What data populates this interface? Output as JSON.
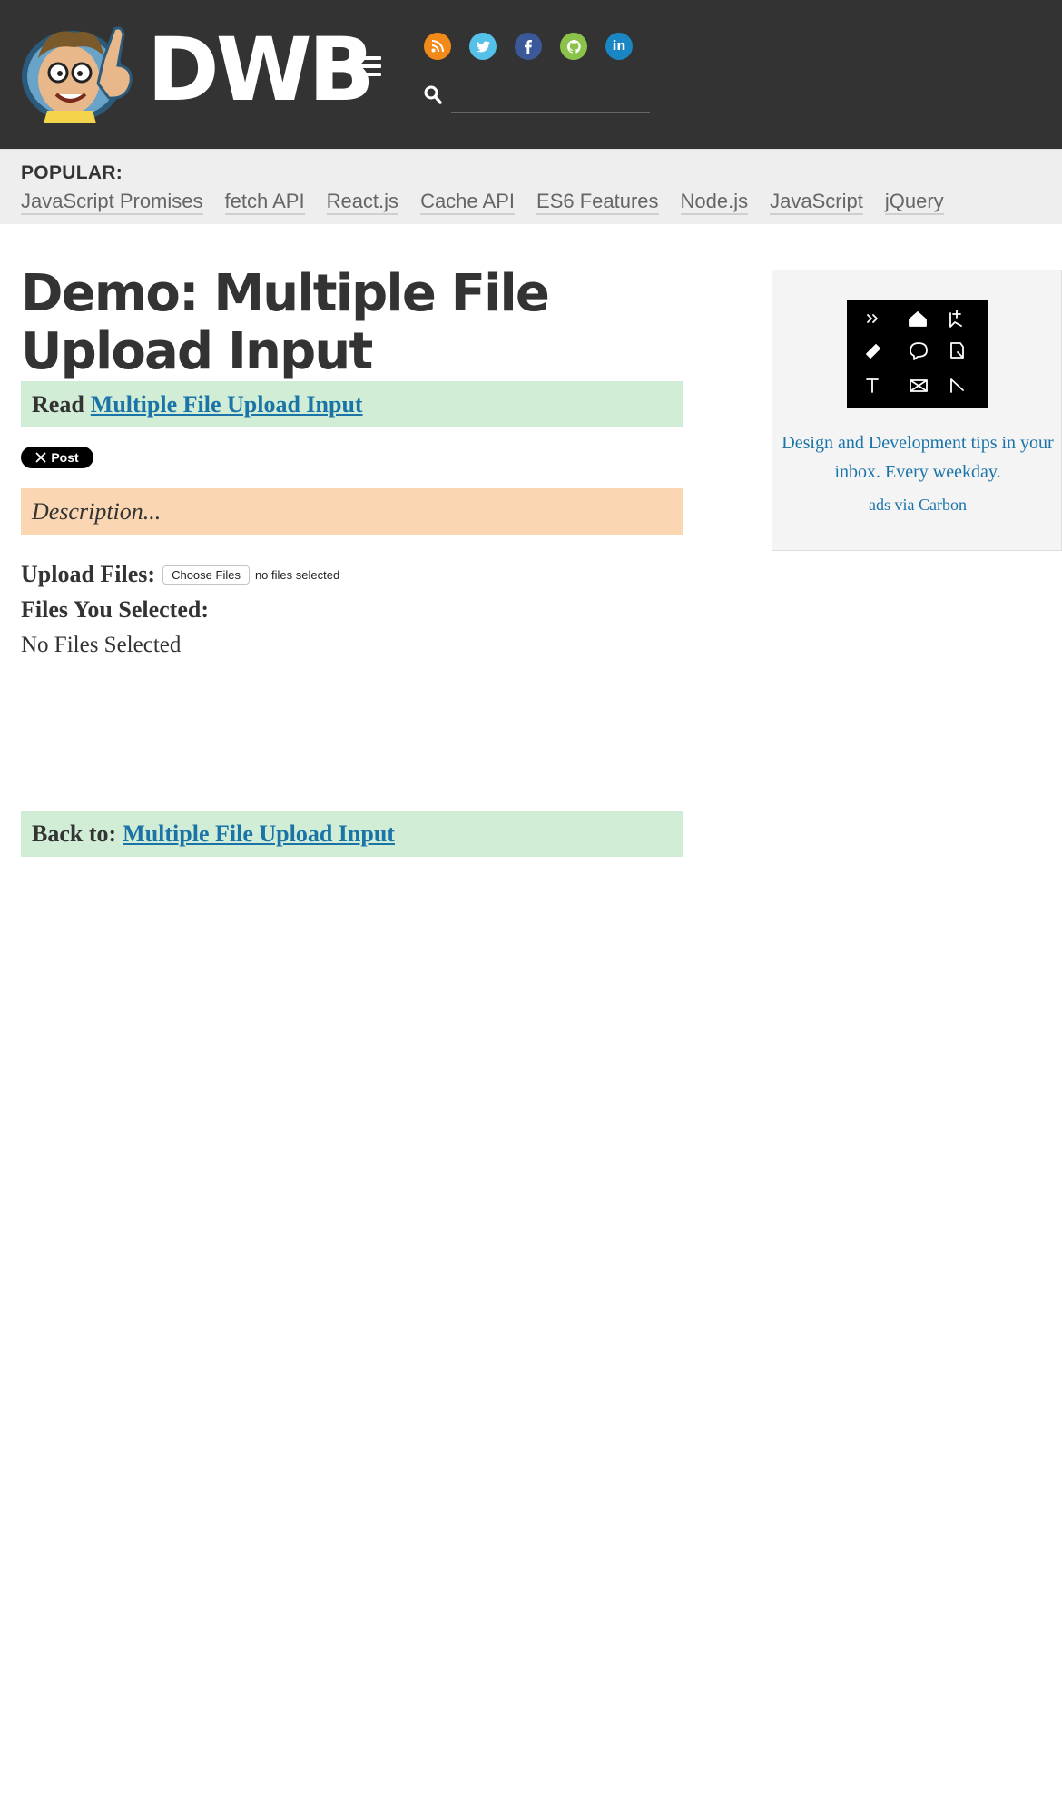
{
  "header": {
    "logo_text": "DWB",
    "social": [
      {
        "name": "rss",
        "color": "#f28a1a",
        "glyph": "rss-icon"
      },
      {
        "name": "twitter",
        "color": "#55c0e8",
        "glyph": "twitter-icon"
      },
      {
        "name": "facebook",
        "color": "#3b5998",
        "glyph": "facebook-icon"
      },
      {
        "name": "github",
        "color": "#8bc34a",
        "glyph": "github-icon"
      },
      {
        "name": "linkedin",
        "color": "#1a86c4",
        "glyph": "linkedin-icon"
      }
    ],
    "search_value": ""
  },
  "popular": {
    "label": "POPULAR:",
    "links": [
      "JavaScript Promises",
      "fetch API",
      "React.js",
      "Cache API",
      "ES6 Features",
      "Node.js",
      "JavaScript",
      "jQuery"
    ]
  },
  "main": {
    "title": "Demo: Multiple File Upload Input",
    "read_prefix": "Read",
    "read_link": "Multiple File Upload Input",
    "x_post_label": "Post",
    "description": "Description...",
    "upload_label": "Upload Files:",
    "choose_button": "Choose Files",
    "no_files_text": "no files selected",
    "selected_label": "Files You Selected:",
    "selected_value": "No Files Selected",
    "back_prefix": "Back to:",
    "back_link": "Multiple File Upload Input"
  },
  "ad": {
    "text": "Design and Development tips in your inbox. Every weekday.",
    "via": "ads via Carbon"
  },
  "colors": {
    "header_bg": "#333333",
    "link": "#1a74a8",
    "green_box": "#d1edd5",
    "orange_box": "#fad7b2"
  }
}
